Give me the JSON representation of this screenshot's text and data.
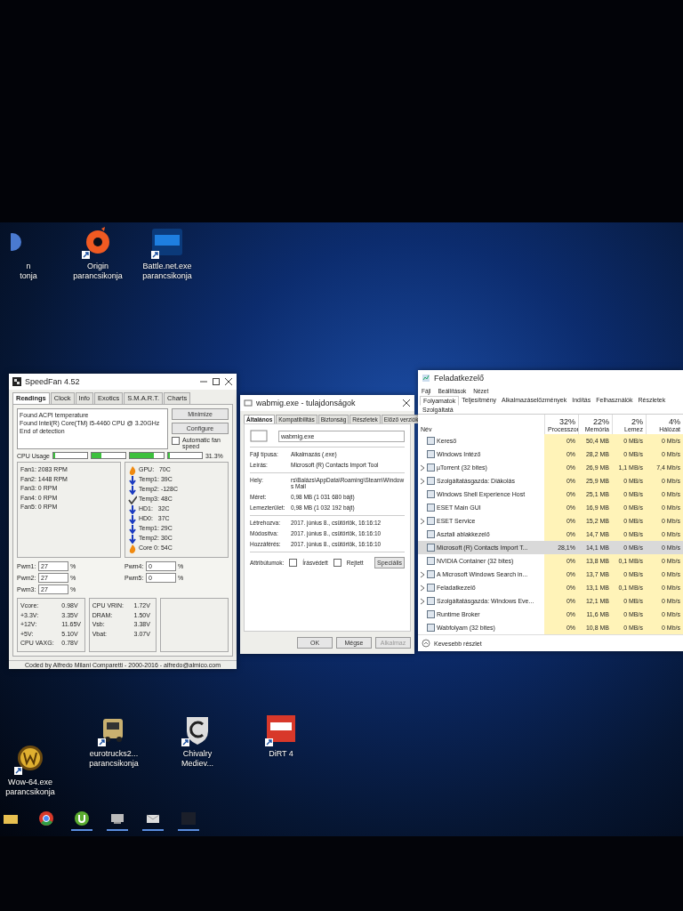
{
  "desktop": {
    "top_icons": [
      {
        "kind": "partial",
        "lines": [
          "n",
          "tonja"
        ]
      },
      {
        "kind": "ring",
        "lines": [
          "Origin",
          "parancsikonja"
        ]
      },
      {
        "kind": "bluebox",
        "lines": [
          "Battle.net.exe",
          "parancsikonja"
        ]
      }
    ],
    "bottom_icons": [
      {
        "kind": "emblem",
        "lines": [
          "Wow-64.exe",
          "parancsikonja"
        ]
      },
      {
        "kind": "truck",
        "lines": [
          "eurotrucks2...",
          "parancsikonja"
        ]
      },
      {
        "kind": "shield",
        "lines": [
          "Chivalry",
          "Mediev..."
        ]
      },
      {
        "kind": "redbox",
        "lines": [
          "DiRT 4"
        ]
      }
    ]
  },
  "speedfan": {
    "title": "SpeedFan 4.52",
    "tabs": [
      {
        "label": "Readings",
        "selected": true
      },
      {
        "label": "Clock",
        "selected": false
      },
      {
        "label": "Info",
        "selected": false
      },
      {
        "label": "Exotics",
        "selected": false
      },
      {
        "label": "S.M.A.R.T.",
        "selected": false
      },
      {
        "label": "Charts",
        "selected": false
      }
    ],
    "log": [
      "Found ACPI temperature",
      "Found Intel(R) Core(TM) i5-4460 CPU @ 3.20GHz",
      "End of detection"
    ],
    "buttons": [
      "Minimize",
      "Configure"
    ],
    "auto_fan": {
      "label": "Automatic fan speed",
      "checked": false
    },
    "cpu_usage": {
      "label": "CPU Usage",
      "meters": [
        {
          "level": 0.05
        },
        {
          "level": 0.3
        },
        {
          "level": 0.7
        },
        {
          "level": 0.05
        }
      ],
      "reading": "31.3%"
    },
    "fans": [
      "Fan1: 2083 RPM",
      "Fan2: 1448 RPM",
      "Fan3: 0 RPM",
      "Fan4: 0 RPM",
      "Fan5: 0 RPM"
    ],
    "temps": [
      {
        "kind": "hot",
        "text": "GPU:   70C"
      },
      {
        "kind": "cold",
        "text": "Temp1: 39C"
      },
      {
        "kind": "cold",
        "text": "Temp2: -128C"
      },
      {
        "kind": "ok",
        "text": "Temp3: 48C"
      },
      {
        "kind": "cold",
        "text": "HD1:   32C"
      },
      {
        "kind": "cold",
        "text": "HD0:   37C"
      },
      {
        "kind": "cold",
        "text": "Temp1: 29C"
      },
      {
        "kind": "cold",
        "text": "Temp2: 30C"
      },
      {
        "kind": "hot",
        "text": "Core 0: 54C"
      }
    ],
    "pwm_left": [
      {
        "label": "Pwm1:",
        "value": "27",
        "unit": "%"
      },
      {
        "label": "Pwm2:",
        "value": "27",
        "unit": "%"
      },
      {
        "label": "Pwm3:",
        "value": "27",
        "unit": "%"
      }
    ],
    "pwm_right": [
      {
        "label": "Pwm4:",
        "value": "0",
        "unit": "%"
      },
      {
        "label": "Pwm5:",
        "value": "0",
        "unit": "%"
      }
    ],
    "volts_left": [
      {
        "name": "Vcore:",
        "value": "0.98V"
      },
      {
        "name": "+3.3V:",
        "value": "3.35V"
      },
      {
        "name": "+12V:",
        "value": "11.65V"
      },
      {
        "name": "+5V:",
        "value": "5.10V"
      },
      {
        "name": "CPU VAXG:",
        "value": "0.78V"
      }
    ],
    "volts_right": [
      {
        "name": "CPU VRIN:",
        "value": "1.72V"
      },
      {
        "name": "DRAM:",
        "value": "1.50V"
      },
      {
        "name": "Vsb:",
        "value": "3.38V"
      },
      {
        "name": "Vbat:",
        "value": "3.07V"
      }
    ],
    "footer": "Coded by Alfredo Milani Comparetti - 2000-2016 - alfredo@almico.com"
  },
  "properties": {
    "title": "wabmig.exe - tulajdonságok",
    "tabs": [
      {
        "label": "Általános",
        "selected": true
      },
      {
        "label": "Kompatibilitás",
        "selected": false
      },
      {
        "label": "Biztonság",
        "selected": false
      },
      {
        "label": "Részletek",
        "selected": false
      },
      {
        "label": "Előző verziók",
        "selected": false
      }
    ],
    "name": "wabmig.exe",
    "groups": [
      [
        {
          "label": "Fájl típusa:",
          "value": "Alkalmazás (.exe)"
        },
        {
          "label": "Leírás:",
          "value": "Microsoft (R) Contacts Import Tool"
        }
      ],
      [
        {
          "label": "Hely:",
          "value": "rs\\Balázs\\AppData\\Roaming\\Steam\\Windows Mail"
        },
        {
          "label": "Méret:",
          "value": "0,98 MB (1 031 680 bájt)"
        },
        {
          "label": "Lemezterület:",
          "value": "0,98 MB (1 032 192 bájt)"
        }
      ],
      [
        {
          "label": "Létrehozva:",
          "value": "2017. június 8., csütörtök, 16:16:12"
        },
        {
          "label": "Módosítva:",
          "value": "2017. június 8., csütörtök, 16:16:10"
        },
        {
          "label": "Hozzáférés:",
          "value": "2017. június 8., csütörtök, 16:16:10"
        }
      ]
    ],
    "attributes": {
      "label": "Attribútumok:",
      "checks": [
        {
          "label": "Írásvédett",
          "checked": false
        },
        {
          "label": "Rejtett",
          "checked": false
        }
      ],
      "button": "Speciális"
    },
    "buttons": [
      {
        "label": "OK",
        "disabled": false
      },
      {
        "label": "Mégse",
        "disabled": false
      },
      {
        "label": "Alkalmaz",
        "disabled": true
      }
    ]
  },
  "task_manager": {
    "title": "Feladatkezelő",
    "menu": [
      "Fájl",
      "Beállítások",
      "Nézet"
    ],
    "tabs": [
      {
        "label": "Folyamatok",
        "selected": true
      },
      {
        "label": "Teljesítmény",
        "selected": false
      },
      {
        "label": "Alkalmazáselőzmények",
        "selected": false
      },
      {
        "label": "Indítás",
        "selected": false
      },
      {
        "label": "Felhasználók",
        "selected": false
      },
      {
        "label": "Részletek",
        "selected": false
      },
      {
        "label": "Szolgáltatá",
        "selected": false
      }
    ],
    "columns": [
      {
        "label": "Név"
      },
      {
        "label": "Processzor",
        "percent": "32%"
      },
      {
        "label": "Memória",
        "percent": "22%"
      },
      {
        "label": "Lemez",
        "percent": "2%"
      },
      {
        "label": "Hálózat",
        "percent": "4%"
      }
    ],
    "rows": [
      {
        "has_children": false,
        "selected": false,
        "cells": [
          "Kereső",
          "0%",
          "50,4 MB",
          "0 MB/s",
          "0 Mb/s"
        ]
      },
      {
        "has_children": false,
        "selected": false,
        "cells": [
          "Windows Intéző",
          "0%",
          "28,2 MB",
          "0 MB/s",
          "0 Mb/s"
        ]
      },
      {
        "has_children": true,
        "selected": false,
        "cells": [
          "µTorrent (32 bites)",
          "0%",
          "26,9 MB",
          "1,1 MB/s",
          "7,4 Mb/s"
        ]
      },
      {
        "has_children": true,
        "selected": false,
        "cells": [
          "Szolgáltatásgazda: Diákolás",
          "0%",
          "25,9 MB",
          "0 MB/s",
          "0 Mb/s"
        ]
      },
      {
        "has_children": false,
        "selected": false,
        "cells": [
          "Windows Shell Experience Host",
          "0%",
          "25,1 MB",
          "0 MB/s",
          "0 Mb/s"
        ]
      },
      {
        "has_children": false,
        "selected": false,
        "cells": [
          "ESET Main GUI",
          "0%",
          "16,9 MB",
          "0 MB/s",
          "0 Mb/s"
        ]
      },
      {
        "has_children": true,
        "selected": false,
        "cells": [
          "ESET Service",
          "0%",
          "15,2 MB",
          "0 MB/s",
          "0 Mb/s"
        ]
      },
      {
        "has_children": false,
        "selected": false,
        "cells": [
          "Asztali ablakkezelő",
          "0%",
          "14,7 MB",
          "0 MB/s",
          "0 Mb/s"
        ]
      },
      {
        "has_children": false,
        "selected": true,
        "cells": [
          "Microsoft (R) Contacts Import T...",
          "28,1%",
          "14,1 MB",
          "0 MB/s",
          "0 Mb/s"
        ]
      },
      {
        "has_children": false,
        "selected": false,
        "cells": [
          "NVIDIA Container (32 bites)",
          "0%",
          "13,8 MB",
          "0,1 MB/s",
          "0 Mb/s"
        ]
      },
      {
        "has_children": true,
        "selected": false,
        "cells": [
          "A Microsoft Windows Search in...",
          "0%",
          "13,7 MB",
          "0 MB/s",
          "0 Mb/s"
        ]
      },
      {
        "has_children": true,
        "selected": false,
        "cells": [
          "Feladatkezelő",
          "0%",
          "13,1 MB",
          "0,1 MB/s",
          "0 Mb/s"
        ]
      },
      {
        "has_children": true,
        "selected": false,
        "cells": [
          "Szolgáltatásgazda: Windows Eve...",
          "0%",
          "12,1 MB",
          "0 MB/s",
          "0 Mb/s"
        ]
      },
      {
        "has_children": false,
        "selected": false,
        "cells": [
          "Runtime Broker",
          "0%",
          "11,6 MB",
          "0 MB/s",
          "0 Mb/s"
        ]
      },
      {
        "has_children": false,
        "selected": false,
        "cells": [
          "Wabfolyam (32 bites)",
          "0%",
          "10,8 MB",
          "0 MB/s",
          "0 Mb/s"
        ]
      }
    ],
    "footer": "Kevesebb részlet"
  },
  "taskbar": [
    {
      "kind": "folder",
      "selected": false
    },
    {
      "kind": "browser",
      "selected": false
    },
    {
      "kind": "torrent",
      "selected": true
    },
    {
      "kind": "device",
      "selected": true
    },
    {
      "kind": "mail",
      "selected": true
    },
    {
      "kind": "blank",
      "selected": true
    }
  ]
}
